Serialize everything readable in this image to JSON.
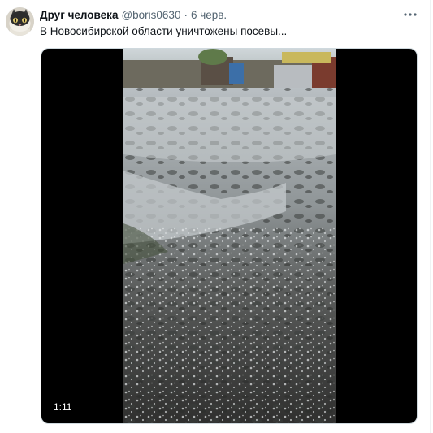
{
  "tweet": {
    "author_name": "Друг человека",
    "author_handle": "@boris0630",
    "separator": "·",
    "timestamp": "6 черв.",
    "text": "В Новосибирской области уничтожены посевы...",
    "more_icon": "ellipsis-horizontal-icon",
    "avatar_icon": "cat-avatar-icon"
  },
  "media": {
    "type": "video",
    "duration": "1:11",
    "description_icon": "video-thumbnail-hail-field"
  },
  "colors": {
    "text_primary": "#0f1419",
    "text_secondary": "#536471",
    "border": "#cfd9de"
  }
}
